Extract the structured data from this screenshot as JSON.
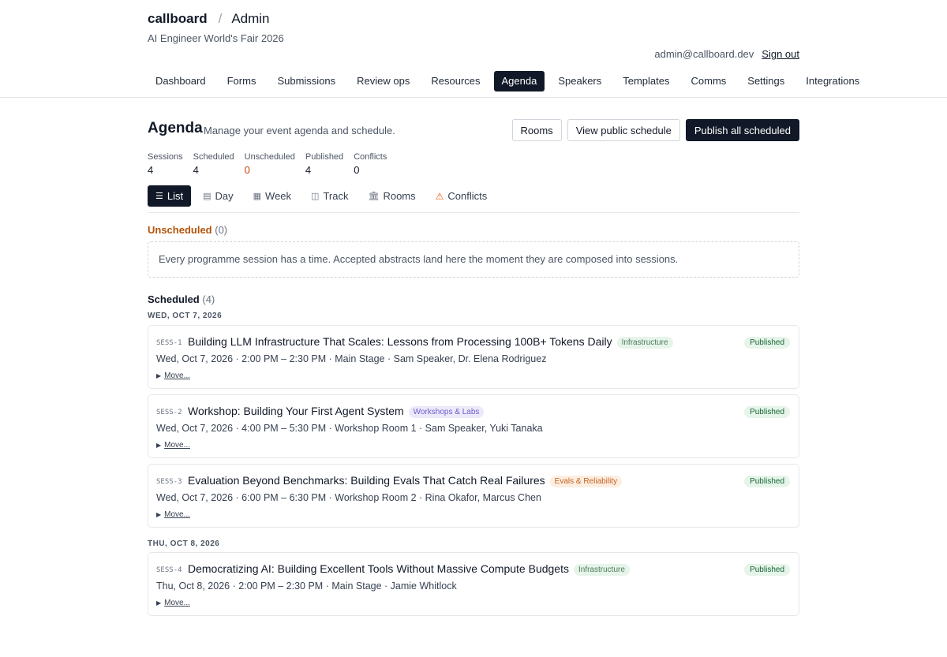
{
  "header": {
    "brand": "callboard",
    "separator": "/",
    "section": "Admin",
    "event_name": "AI Engineer World's Fair 2026",
    "user_email": "admin@callboard.dev",
    "sign_out": "Sign out"
  },
  "nav": {
    "tabs": [
      {
        "label": "Dashboard"
      },
      {
        "label": "Forms"
      },
      {
        "label": "Submissions"
      },
      {
        "label": "Review ops"
      },
      {
        "label": "Resources"
      },
      {
        "label": "Agenda",
        "active": true
      },
      {
        "label": "Speakers"
      },
      {
        "label": "Templates"
      },
      {
        "label": "Comms"
      },
      {
        "label": "Settings"
      },
      {
        "label": "Integrations"
      }
    ]
  },
  "page": {
    "title": "Agenda",
    "subtitle": "Manage your event agenda and schedule.",
    "actions": {
      "rooms": "Rooms",
      "view_public": "View public schedule",
      "publish_all": "Publish all scheduled"
    }
  },
  "stats": [
    {
      "label": "Sessions",
      "value": "4"
    },
    {
      "label": "Scheduled",
      "value": "4"
    },
    {
      "label": "Unscheduled",
      "value": "0"
    },
    {
      "label": "Published",
      "value": "4"
    },
    {
      "label": "Conflicts",
      "value": "0"
    }
  ],
  "views": {
    "list": {
      "label": "List",
      "icon": "☰"
    },
    "day": {
      "label": "Day",
      "icon": "▤"
    },
    "week": {
      "label": "Week",
      "icon": "▦"
    },
    "track": {
      "label": "Track",
      "icon": "◫"
    },
    "rooms": {
      "label": "Rooms",
      "icon": "🏛"
    },
    "conflicts": {
      "label": "Conflicts",
      "icon": "⚠"
    }
  },
  "unscheduled": {
    "label": "Unscheduled",
    "count": "(0)",
    "empty_message": "Every programme session has a time. Accepted abstracts land here the moment they are composed into sessions."
  },
  "scheduled": {
    "label": "Scheduled",
    "count": "(4)",
    "dates": [
      {
        "label": "WED, OCT 7, 2026"
      },
      {
        "label": "THU, OCT 8, 2026"
      }
    ],
    "sessions": [
      {
        "id": "SESS-1",
        "title": "Building LLM Infrastructure That Scales: Lessons from Processing 100B+ Tokens Daily",
        "track": "Infrastructure",
        "track_color": "#e6f4ea",
        "meta": "Wed, Oct 7, 2026 · 2:00 PM – 2:30 PM · Main Stage · Sam Speaker, Dr. Elena Rodriguez",
        "move": "Move...",
        "status": "Published"
      },
      {
        "id": "SESS-2",
        "title": "Workshop: Building Your First Agent System",
        "track": "Workshops & Labs",
        "track_color": "#ece9fb",
        "meta": "Wed, Oct 7, 2026 · 4:00 PM – 5:30 PM · Workshop Room 1 · Sam Speaker, Yuki Tanaka",
        "move": "Move...",
        "status": "Published"
      },
      {
        "id": "SESS-3",
        "title": "Evaluation Beyond Benchmarks: Building Evals That Catch Real Failures",
        "track": "Evals & Reliability",
        "track_color": "#fdeee2",
        "meta": "Wed, Oct 7, 2026 · 6:00 PM – 6:30 PM · Workshop Room 2 · Rina Okafor, Marcus Chen",
        "move": "Move...",
        "status": "Published"
      },
      {
        "id": "SESS-4",
        "title": "Democratizing AI: Building Excellent Tools Without Massive Compute Budgets",
        "track": "Infrastructure",
        "track_color": "#e6f4ea",
        "meta": "Thu, Oct 8, 2026 · 2:00 PM – 2:30 PM · Main Stage · Jamie Whitlock",
        "move": "Move...",
        "status": "Published"
      }
    ]
  }
}
